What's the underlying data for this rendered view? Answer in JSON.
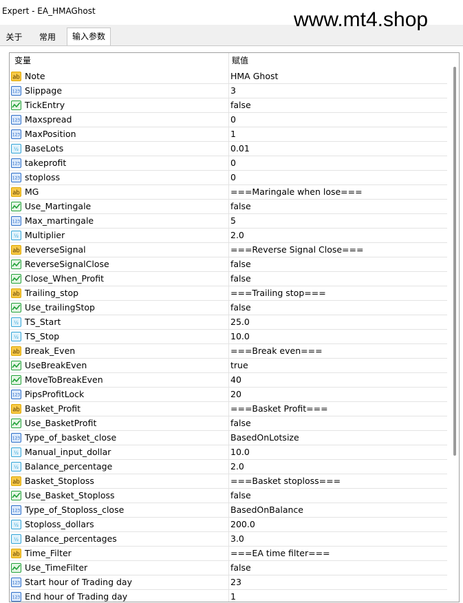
{
  "window": {
    "title": "Expert - EA_HMAGhost"
  },
  "watermark": "www.mt4.shop",
  "tabs": [
    {
      "label": "关于"
    },
    {
      "label": "常用"
    },
    {
      "label": "输入参数"
    }
  ],
  "active_tab": 2,
  "columns": {
    "name": "变量",
    "value": "赋值"
  },
  "icon_colors": {
    "string": "#e0a800",
    "int": "#2e6fc9",
    "bool": "#23a23a",
    "double": "#36a6d8"
  },
  "rows": [
    {
      "name": "Note",
      "value": "HMA Ghost",
      "type": "string"
    },
    {
      "name": "Slippage",
      "value": "3",
      "type": "int"
    },
    {
      "name": "TickEntry",
      "value": "false",
      "type": "bool"
    },
    {
      "name": "Maxspread",
      "value": "0",
      "type": "int"
    },
    {
      "name": "MaxPosition",
      "value": "1",
      "type": "int"
    },
    {
      "name": "BaseLots",
      "value": "0.01",
      "type": "double"
    },
    {
      "name": "takeprofit",
      "value": "0",
      "type": "int"
    },
    {
      "name": "stoploss",
      "value": "0",
      "type": "int"
    },
    {
      "name": "MG",
      "value": "===Maringale when lose===",
      "type": "string"
    },
    {
      "name": "Use_Martingale",
      "value": "false",
      "type": "bool"
    },
    {
      "name": "Max_martingale",
      "value": "5",
      "type": "int"
    },
    {
      "name": "Multiplier",
      "value": "2.0",
      "type": "double"
    },
    {
      "name": "ReverseSignal",
      "value": "===Reverse Signal Close===",
      "type": "string"
    },
    {
      "name": "ReverseSignalClose",
      "value": "false",
      "type": "bool"
    },
    {
      "name": "Close_When_Profit",
      "value": "false",
      "type": "bool"
    },
    {
      "name": "Trailing_stop",
      "value": "===Trailing stop===",
      "type": "string"
    },
    {
      "name": "Use_trailingStop",
      "value": "false",
      "type": "bool"
    },
    {
      "name": "TS_Start",
      "value": "25.0",
      "type": "double"
    },
    {
      "name": "TS_Stop",
      "value": "10.0",
      "type": "double"
    },
    {
      "name": "Break_Even",
      "value": "===Break even===",
      "type": "string"
    },
    {
      "name": "UseBreakEven",
      "value": "true",
      "type": "bool"
    },
    {
      "name": "MoveToBreakEven",
      "value": "40",
      "type": "bool"
    },
    {
      "name": "PipsProfitLock",
      "value": "20",
      "type": "int"
    },
    {
      "name": "Basket_Profit",
      "value": "===Basket Profit===",
      "type": "string"
    },
    {
      "name": "Use_BasketProfit",
      "value": "false",
      "type": "bool"
    },
    {
      "name": "Type_of_basket_close",
      "value": "BasedOnLotsize",
      "type": "int"
    },
    {
      "name": "Manual_input_dollar",
      "value": "10.0",
      "type": "double"
    },
    {
      "name": "Balance_percentage",
      "value": "2.0",
      "type": "double"
    },
    {
      "name": "Basket_Stoploss",
      "value": "===Basket stoploss===",
      "type": "string"
    },
    {
      "name": "Use_Basket_Stoploss",
      "value": "false",
      "type": "bool"
    },
    {
      "name": "Type_of_Stoploss_close",
      "value": "BasedOnBalance",
      "type": "int"
    },
    {
      "name": "Stoploss_dollars",
      "value": "200.0",
      "type": "double"
    },
    {
      "name": "Balance_percentages",
      "value": "3.0",
      "type": "double"
    },
    {
      "name": "Time_Filter",
      "value": "===EA time filter===",
      "type": "string"
    },
    {
      "name": "Use_TimeFilter",
      "value": "false",
      "type": "bool"
    },
    {
      "name": "Start hour of Trading day",
      "value": "23",
      "type": "int"
    },
    {
      "name": "End hour of Trading day",
      "value": "1",
      "type": "int"
    }
  ]
}
